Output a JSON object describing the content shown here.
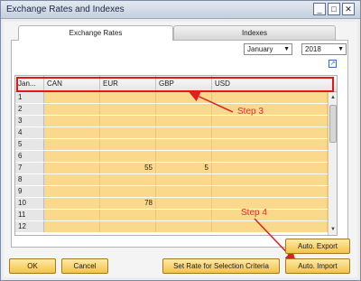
{
  "window": {
    "title": "Exchange Rates and Indexes",
    "controls": {
      "minimize": "_",
      "maximize": "□",
      "close": "✕"
    }
  },
  "tabs": [
    {
      "label": "Exchange Rates",
      "active": true
    },
    {
      "label": "Indexes",
      "active": false
    }
  ],
  "filters": {
    "month": "January",
    "year": "2018"
  },
  "grid": {
    "columns": [
      "Jan...",
      "CAN",
      "EUR",
      "GBP",
      "USD"
    ],
    "rows": [
      {
        "num": "1",
        "CAN": "",
        "EUR": "",
        "GBP": "",
        "USD": ""
      },
      {
        "num": "2",
        "CAN": "",
        "EUR": "",
        "GBP": "",
        "USD": ""
      },
      {
        "num": "3",
        "CAN": "",
        "EUR": "",
        "GBP": "",
        "USD": ""
      },
      {
        "num": "4",
        "CAN": "",
        "EUR": "",
        "GBP": "",
        "USD": ""
      },
      {
        "num": "5",
        "CAN": "",
        "EUR": "",
        "GBP": "",
        "USD": ""
      },
      {
        "num": "6",
        "CAN": "",
        "EUR": "",
        "GBP": "",
        "USD": ""
      },
      {
        "num": "7",
        "CAN": "",
        "EUR": "55",
        "GBP": "5",
        "USD": ""
      },
      {
        "num": "8",
        "CAN": "",
        "EUR": "",
        "GBP": "",
        "USD": ""
      },
      {
        "num": "9",
        "CAN": "",
        "EUR": "",
        "GBP": "",
        "USD": ""
      },
      {
        "num": "10",
        "CAN": "",
        "EUR": "78",
        "GBP": "",
        "USD": ""
      },
      {
        "num": "11",
        "CAN": "",
        "EUR": "",
        "GBP": "",
        "USD": ""
      },
      {
        "num": "12",
        "CAN": "",
        "EUR": "",
        "GBP": "",
        "USD": ""
      }
    ]
  },
  "annotations": {
    "step3": "Step 3",
    "step4": "Step 4",
    "color": "#e02020"
  },
  "buttons": {
    "ok": "OK",
    "cancel": "Cancel",
    "set_rate": "Set Rate for Selection Criteria",
    "auto_export": "Auto. Export",
    "auto_import": "Auto. Import"
  },
  "colors": {
    "row_fill": "#fbd98c",
    "button_fill": "#f4c347",
    "highlight": "#e01818"
  }
}
